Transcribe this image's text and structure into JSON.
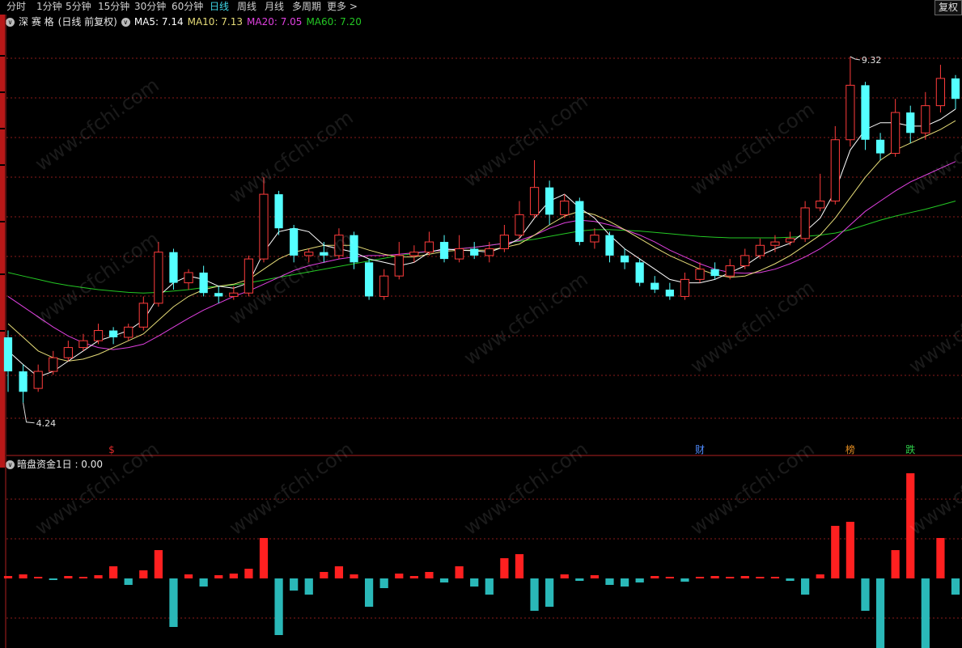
{
  "toolbar": {
    "periods": [
      "分时",
      "1分钟",
      "5分钟",
      "15分钟",
      "30分钟",
      "60分钟",
      "日线",
      "周线",
      "月线",
      "多周期",
      "更多 >"
    ],
    "active_index": 6,
    "adjust_label": "复权"
  },
  "info": {
    "stock_name": "深 赛 格",
    "mode": "(日线 前复权)",
    "ma5": "MA5: 7.14",
    "ma10": "MA10: 7.13",
    "ma20": "MA20: 7.05",
    "ma60": "MA60: 7.20"
  },
  "indicator": {
    "label": "暗盘资金1日 : 0.00"
  },
  "event_markers": [
    {
      "label": "$",
      "index": 7,
      "color": "#e02a2a"
    },
    {
      "label": "财",
      "index": 46,
      "color": "#4f8cff"
    },
    {
      "label": "榜",
      "index": 56,
      "color": "#e08a20"
    },
    {
      "label": "跌",
      "index": 60,
      "color": "#2fd04a"
    }
  ],
  "watermark": "www.cfchi.com",
  "colors": {
    "up": "#ff3c3c",
    "down": "#54ffff",
    "ma5": "#ffffff",
    "ma10": "#e6dc78",
    "ma20": "#e040e0",
    "ma60": "#24c824",
    "grid": "#8a1c1c"
  },
  "chart_data": {
    "type": "candlestick",
    "price_high_label": "9.32",
    "price_low_label": "4.24",
    "y_range": [
      4.0,
      9.7
    ],
    "candles": [
      [
        5.2,
        4.7,
        5.3,
        4.4
      ],
      [
        4.7,
        4.4,
        4.8,
        4.24
      ],
      [
        4.45,
        4.7,
        4.8,
        4.4
      ],
      [
        4.7,
        4.9,
        5.0,
        4.65
      ],
      [
        4.9,
        5.05,
        5.15,
        4.85
      ],
      [
        5.05,
        5.15,
        5.25,
        5.0
      ],
      [
        5.15,
        5.3,
        5.4,
        5.1
      ],
      [
        5.3,
        5.2,
        5.35,
        5.1
      ],
      [
        5.2,
        5.35,
        5.4,
        5.15
      ],
      [
        5.35,
        5.7,
        5.8,
        5.3
      ],
      [
        5.7,
        6.45,
        6.6,
        5.65
      ],
      [
        6.45,
        6.0,
        6.5,
        5.9
      ],
      [
        6.0,
        6.15,
        6.2,
        5.9
      ],
      [
        6.15,
        5.85,
        6.25,
        5.8
      ],
      [
        5.85,
        5.8,
        5.95,
        5.7
      ],
      [
        5.8,
        5.85,
        5.95,
        5.75
      ],
      [
        5.85,
        6.35,
        6.4,
        5.8
      ],
      [
        6.35,
        7.3,
        7.55,
        6.3
      ],
      [
        7.3,
        6.8,
        7.35,
        6.7
      ],
      [
        6.8,
        6.4,
        6.85,
        6.3
      ],
      [
        6.4,
        6.45,
        6.5,
        6.3
      ],
      [
        6.45,
        6.4,
        6.6,
        6.3
      ],
      [
        6.4,
        6.7,
        6.8,
        6.35
      ],
      [
        6.7,
        6.3,
        6.75,
        6.2
      ],
      [
        6.3,
        5.8,
        6.35,
        5.75
      ],
      [
        5.8,
        6.1,
        6.2,
        5.75
      ],
      [
        6.1,
        6.4,
        6.6,
        6.05
      ],
      [
        6.4,
        6.45,
        6.55,
        6.3
      ],
      [
        6.45,
        6.6,
        6.75,
        6.4
      ],
      [
        6.6,
        6.35,
        6.7,
        6.3
      ],
      [
        6.35,
        6.5,
        6.7,
        6.3
      ],
      [
        6.5,
        6.4,
        6.6,
        6.35
      ],
      [
        6.4,
        6.5,
        6.6,
        6.3
      ],
      [
        6.5,
        6.7,
        6.85,
        6.45
      ],
      [
        6.7,
        7.0,
        7.2,
        6.65
      ],
      [
        7.0,
        7.4,
        7.8,
        6.95
      ],
      [
        7.4,
        7.0,
        7.5,
        6.85
      ],
      [
        7.0,
        7.2,
        7.3,
        6.95
      ],
      [
        7.2,
        6.6,
        7.25,
        6.55
      ],
      [
        6.6,
        6.7,
        6.8,
        6.5
      ],
      [
        6.7,
        6.4,
        6.75,
        6.3
      ],
      [
        6.4,
        6.3,
        6.5,
        6.2
      ],
      [
        6.3,
        6.0,
        6.35,
        5.95
      ],
      [
        6.0,
        5.9,
        6.1,
        5.85
      ],
      [
        5.9,
        5.8,
        6.0,
        5.75
      ],
      [
        5.8,
        6.05,
        6.15,
        5.75
      ],
      [
        6.05,
        6.2,
        6.3,
        6.0
      ],
      [
        6.2,
        6.1,
        6.3,
        6.05
      ],
      [
        6.1,
        6.25,
        6.35,
        6.05
      ],
      [
        6.25,
        6.4,
        6.5,
        6.2
      ],
      [
        6.4,
        6.55,
        6.65,
        6.35
      ],
      [
        6.55,
        6.6,
        6.7,
        6.45
      ],
      [
        6.6,
        6.65,
        6.75,
        6.55
      ],
      [
        6.65,
        7.1,
        7.2,
        6.6
      ],
      [
        7.1,
        7.2,
        7.6,
        7.05
      ],
      [
        7.2,
        8.1,
        8.3,
        7.15
      ],
      [
        8.1,
        8.9,
        9.32,
        8.0
      ],
      [
        8.9,
        8.1,
        8.95,
        7.95
      ],
      [
        8.1,
        7.9,
        8.2,
        7.8
      ],
      [
        7.9,
        8.5,
        8.7,
        7.85
      ],
      [
        8.5,
        8.2,
        8.6,
        8.05
      ],
      [
        8.2,
        8.6,
        8.8,
        8.1
      ],
      [
        8.6,
        9.0,
        9.2,
        8.5
      ],
      [
        9.0,
        8.7,
        9.05,
        8.55
      ]
    ],
    "ma5": [
      5.0,
      4.8,
      4.62,
      4.7,
      4.85,
      5.0,
      5.15,
      5.22,
      5.3,
      5.45,
      5.8,
      6.0,
      6.1,
      6.05,
      5.95,
      5.92,
      6.0,
      6.45,
      6.75,
      6.8,
      6.75,
      6.55,
      6.5,
      6.45,
      6.35,
      6.3,
      6.25,
      6.3,
      6.45,
      6.5,
      6.48,
      6.47,
      6.45,
      6.53,
      6.65,
      6.95,
      7.2,
      7.3,
      7.1,
      6.95,
      6.7,
      6.5,
      6.35,
      6.2,
      6.05,
      6.0,
      6.0,
      6.05,
      6.15,
      6.25,
      6.4,
      6.5,
      6.58,
      6.75,
      6.95,
      7.35,
      7.95,
      8.25,
      8.35,
      8.35,
      8.3,
      8.3,
      8.4,
      8.55
    ],
    "ma10": [
      5.4,
      5.2,
      5.0,
      4.9,
      4.85,
      4.88,
      4.95,
      5.05,
      5.15,
      5.25,
      5.45,
      5.65,
      5.8,
      5.9,
      5.95,
      5.98,
      6.05,
      6.2,
      6.35,
      6.45,
      6.5,
      6.55,
      6.55,
      6.55,
      6.48,
      6.42,
      6.38,
      6.38,
      6.42,
      6.46,
      6.48,
      6.48,
      6.48,
      6.52,
      6.57,
      6.7,
      6.85,
      6.98,
      7.05,
      7.0,
      6.9,
      6.78,
      6.65,
      6.52,
      6.4,
      6.3,
      6.2,
      6.12,
      6.08,
      6.1,
      6.18,
      6.28,
      6.4,
      6.55,
      6.7,
      6.95,
      7.25,
      7.55,
      7.8,
      7.95,
      8.05,
      8.15,
      8.25,
      8.38
    ],
    "ma20": [
      5.8,
      5.65,
      5.5,
      5.35,
      5.22,
      5.12,
      5.05,
      5.02,
      5.05,
      5.1,
      5.22,
      5.35,
      5.48,
      5.6,
      5.7,
      5.8,
      5.88,
      5.98,
      6.08,
      6.18,
      6.25,
      6.3,
      6.35,
      6.38,
      6.4,
      6.4,
      6.42,
      6.44,
      6.46,
      6.48,
      6.5,
      6.52,
      6.55,
      6.58,
      6.62,
      6.7,
      6.8,
      6.88,
      6.92,
      6.9,
      6.85,
      6.78,
      6.7,
      6.6,
      6.48,
      6.38,
      6.28,
      6.2,
      6.15,
      6.14,
      6.15,
      6.2,
      6.28,
      6.38,
      6.5,
      6.65,
      6.85,
      7.05,
      7.2,
      7.35,
      7.48,
      7.58,
      7.68,
      7.78
    ],
    "ma60": [
      6.15,
      6.1,
      6.05,
      6.0,
      5.96,
      5.93,
      5.9,
      5.88,
      5.86,
      5.85,
      5.86,
      5.88,
      5.9,
      5.93,
      5.95,
      5.97,
      6.0,
      6.04,
      6.08,
      6.12,
      6.16,
      6.2,
      6.24,
      6.28,
      6.32,
      6.36,
      6.4,
      6.43,
      6.46,
      6.48,
      6.5,
      6.52,
      6.55,
      6.58,
      6.61,
      6.64,
      6.68,
      6.72,
      6.76,
      6.78,
      6.78,
      6.77,
      6.76,
      6.74,
      6.72,
      6.7,
      6.68,
      6.67,
      6.66,
      6.66,
      6.66,
      6.66,
      6.67,
      6.68,
      6.7,
      6.73,
      6.78,
      6.85,
      6.92,
      6.98,
      7.03,
      7.08,
      7.14,
      7.2
    ],
    "fund_flow": [
      0.3,
      0.5,
      0.2,
      -0.2,
      0.3,
      0.2,
      0.4,
      1.5,
      -0.8,
      1.0,
      3.5,
      -6.0,
      0.5,
      -1.0,
      0.4,
      0.6,
      1.2,
      5.0,
      -7.0,
      -1.5,
      -2.0,
      0.8,
      1.5,
      0.5,
      -3.5,
      -1.2,
      0.6,
      0.3,
      0.8,
      -0.5,
      1.5,
      -1.0,
      -2.0,
      2.5,
      3.0,
      -4.0,
      -3.5,
      0.5,
      -0.3,
      0.4,
      -0.8,
      -1.0,
      -0.5,
      0.3,
      0.2,
      -0.4,
      0.2,
      0.3,
      0.2,
      0.3,
      0.2,
      0.2,
      -0.3,
      -2.0,
      0.5,
      6.5,
      7.0,
      -4.0,
      -9.0,
      3.5,
      13.0,
      -10.0,
      5.0,
      -2.0
    ]
  }
}
